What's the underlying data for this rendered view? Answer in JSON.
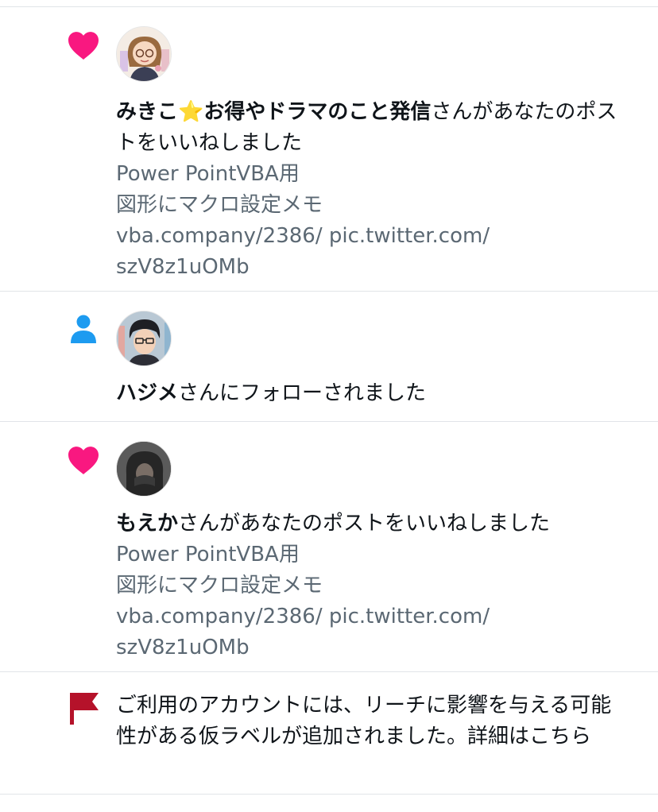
{
  "notifications": [
    {
      "type": "like",
      "icon": "heart-icon",
      "user": "みきこ⭐お得やドラマのこと発信",
      "action": "さんがあなたのポストをいいねしました",
      "preview": [
        "Power PointVBA用",
        "図形にマクロ設定メモ",
        "vba.company/2386/ pic.twitter.com/",
        "szV8z1uOMb"
      ]
    },
    {
      "type": "follow",
      "icon": "person-icon",
      "user": "ハジメ",
      "action": "さんにフォローされました"
    },
    {
      "type": "like",
      "icon": "heart-icon",
      "user": "もえか",
      "action": "さんがあなたのポストをいいねしました",
      "preview": [
        "Power PointVBA用",
        "図形にマクロ設定メモ",
        "vba.company/2386/ pic.twitter.com/",
        "szV8z1uOMb"
      ]
    },
    {
      "type": "system",
      "icon": "flag-icon",
      "message": "ご利用のアカウントには、リーチに影響を与える可能性がある仮ラベルが追加されました。詳細はこちら"
    }
  ],
  "colors": {
    "like": "#f91880",
    "follow": "#1d9bf0",
    "flag": "#b5122a",
    "secondary_text": "#5b6873",
    "divider": "#e1e4e8"
  }
}
